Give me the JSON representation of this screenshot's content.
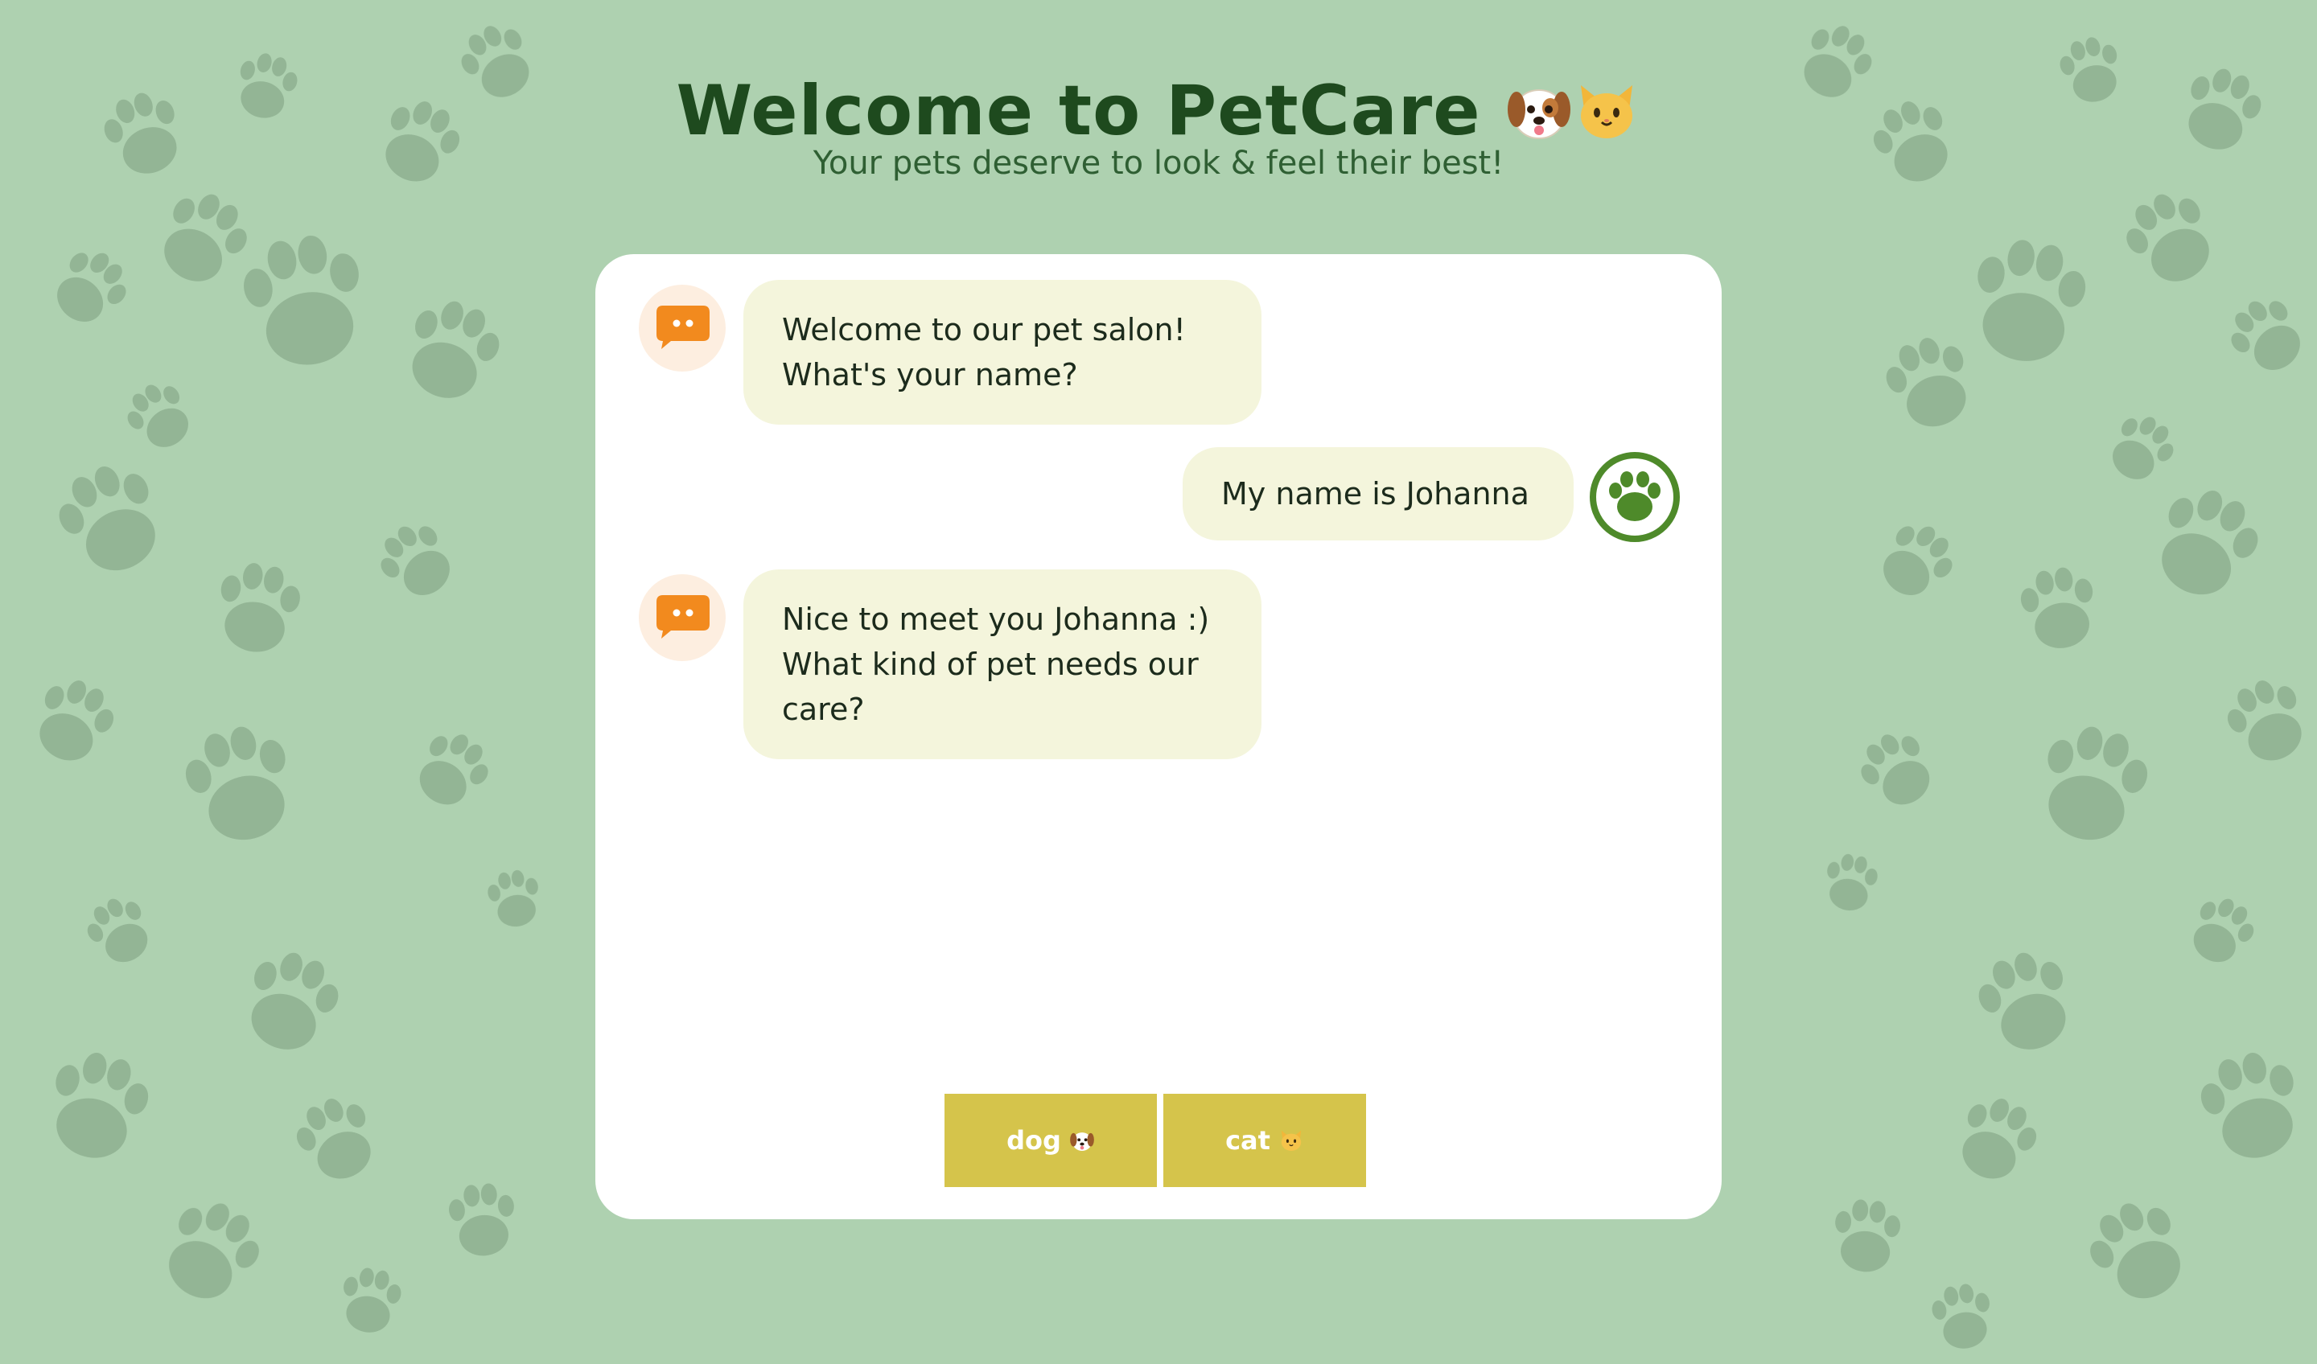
{
  "header": {
    "title": "Welcome to PetCare",
    "title_icons": [
      "dog-face-icon",
      "cat-face-icon"
    ],
    "subtitle": "Your pets deserve to look & feel their best!"
  },
  "chat": {
    "messages": [
      {
        "sender": "bot",
        "lines": [
          "Welcome to our pet salon!",
          "What's your name?"
        ]
      },
      {
        "sender": "user",
        "lines": [
          "My name is Johanna"
        ]
      },
      {
        "sender": "bot",
        "lines": [
          "Nice to meet you Johanna :)",
          "What kind of pet needs our",
          "care?"
        ]
      }
    ],
    "options": [
      {
        "label": "dog",
        "icon": "dog-face-icon"
      },
      {
        "label": "cat",
        "icon": "cat-face-icon"
      }
    ]
  },
  "colors": {
    "background": "#aed1b0",
    "title": "#1e4a1e",
    "bubble": "#f4f5dc",
    "bot_icon": "#f28a1e",
    "user_icon": "#4e8a2a",
    "button": "#d5c44b"
  }
}
